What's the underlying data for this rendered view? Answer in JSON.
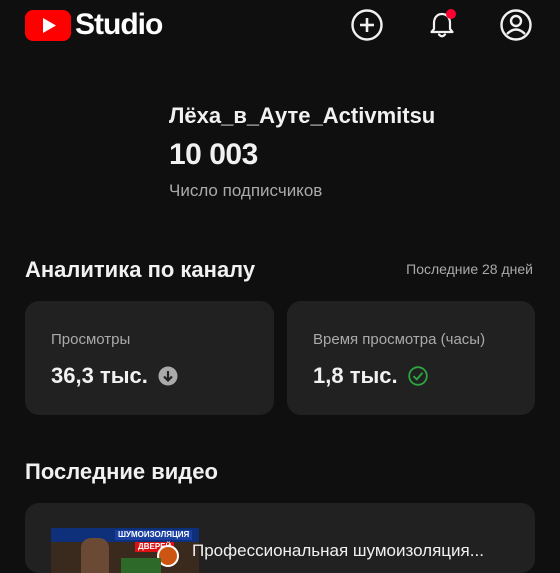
{
  "header": {
    "logo_text": "Studio",
    "icons": [
      "youtube-logo-icon",
      "create-icon",
      "notifications-icon",
      "account-icon"
    ],
    "has_notification": true
  },
  "channel": {
    "name": "Лёха_в_Ауте_Activmitsu",
    "subscribers": "10 003",
    "subscribers_label": "Число подписчиков"
  },
  "analytics": {
    "title": "Аналитика по каналу",
    "period": "Последние 28 дней",
    "cards": [
      {
        "label": "Просмотры",
        "value": "36,3 тыс.",
        "trend_icon": "down-arrow-circle-icon"
      },
      {
        "label": "Время просмотра (часы)",
        "value": "1,8 тыс.",
        "trend_icon": "check-circle-icon"
      }
    ]
  },
  "recent_videos": {
    "title": "Последние видео",
    "items": [
      {
        "title": "Профессиональная шумоизоляция...",
        "thumb_text": [
          "ШУМОИЗОЛЯЦИЯ",
          "ДВЕРЕЙ"
        ]
      }
    ]
  },
  "colors": {
    "background": "#0f0f0f",
    "card": "#212121",
    "brand_red": "#ff0000",
    "notification_dot": "#ff0033",
    "success_green": "#2ba640",
    "secondary_text": "#aaaaaa"
  }
}
